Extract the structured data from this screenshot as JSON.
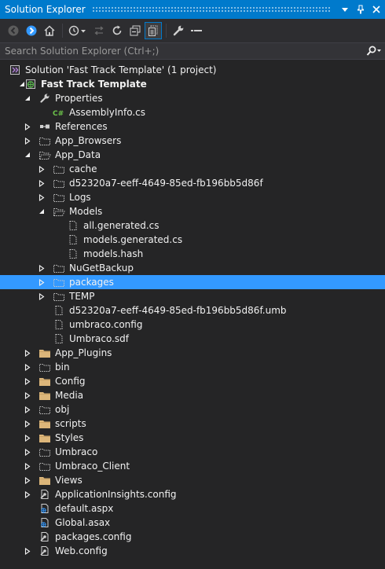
{
  "window": {
    "title": "Solution Explorer",
    "accent_color": "#007acc",
    "selection_color": "#3399ff",
    "title_icons": [
      "dropdown-arrow-icon",
      "pin-icon",
      "close-icon"
    ]
  },
  "toolbar": {
    "buttons": [
      "back-icon",
      "forward-icon",
      "home-icon",
      "history-icon",
      "sync-icon",
      "refresh-icon",
      "collapse-all-icon",
      "show-all-files-icon",
      "properties-wrench-icon",
      "preview-icon"
    ]
  },
  "search": {
    "placeholder": "Search Solution Explorer (Ctrl+;)"
  },
  "tree": {
    "items": [
      {
        "label": "Solution 'Fast Track Template' (1 project)",
        "icon": "solution",
        "depth": 0,
        "expander": "none",
        "bold": false
      },
      {
        "label": "Fast Track Template",
        "icon": "web-project",
        "depth": 1,
        "expander": "expanded",
        "bold": true
      },
      {
        "label": "Properties",
        "icon": "wrench",
        "depth": 2,
        "expander": "expanded",
        "bold": false
      },
      {
        "label": "AssemblyInfo.cs",
        "icon": "csharp",
        "depth": 3,
        "expander": "none",
        "bold": false
      },
      {
        "label": "References",
        "icon": "references",
        "depth": 2,
        "expander": "collapsed",
        "bold": false
      },
      {
        "label": "App_Browsers",
        "icon": "folder-dotted",
        "depth": 2,
        "expander": "collapsed",
        "bold": false
      },
      {
        "label": "App_Data",
        "icon": "folder-dotted-open",
        "depth": 2,
        "expander": "expanded",
        "bold": false
      },
      {
        "label": "cache",
        "icon": "folder-dotted",
        "depth": 3,
        "expander": "collapsed",
        "bold": false
      },
      {
        "label": "d52320a7-eeff-4649-85ed-fb196bb5d86f",
        "icon": "folder-dotted",
        "depth": 3,
        "expander": "collapsed",
        "bold": false
      },
      {
        "label": "Logs",
        "icon": "folder-dotted",
        "depth": 3,
        "expander": "collapsed",
        "bold": false
      },
      {
        "label": "Models",
        "icon": "folder-dotted-open",
        "depth": 3,
        "expander": "expanded",
        "bold": false
      },
      {
        "label": "all.generated.cs",
        "icon": "file-dotted",
        "depth": 4,
        "expander": "none",
        "bold": false
      },
      {
        "label": "models.generated.cs",
        "icon": "file-dotted",
        "depth": 4,
        "expander": "none",
        "bold": false
      },
      {
        "label": "models.hash",
        "icon": "file-dotted",
        "depth": 4,
        "expander": "none",
        "bold": false
      },
      {
        "label": "NuGetBackup",
        "icon": "folder-dotted",
        "depth": 3,
        "expander": "collapsed",
        "bold": false
      },
      {
        "label": "packages",
        "icon": "folder-dotted",
        "depth": 3,
        "expander": "collapsed",
        "bold": false,
        "selected": true
      },
      {
        "label": "TEMP",
        "icon": "folder-dotted",
        "depth": 3,
        "expander": "collapsed",
        "bold": false
      },
      {
        "label": "d52320a7-eeff-4649-85ed-fb196bb5d86f.umb",
        "icon": "file-dotted",
        "depth": 3,
        "expander": "none",
        "bold": false
      },
      {
        "label": "umbraco.config",
        "icon": "file-dotted",
        "depth": 3,
        "expander": "none",
        "bold": false
      },
      {
        "label": "Umbraco.sdf",
        "icon": "file-dotted",
        "depth": 3,
        "expander": "none",
        "bold": false
      },
      {
        "label": "App_Plugins",
        "icon": "folder",
        "depth": 2,
        "expander": "collapsed",
        "bold": false
      },
      {
        "label": "bin",
        "icon": "folder-dotted",
        "depth": 2,
        "expander": "collapsed",
        "bold": false
      },
      {
        "label": "Config",
        "icon": "folder",
        "depth": 2,
        "expander": "collapsed",
        "bold": false
      },
      {
        "label": "Media",
        "icon": "folder",
        "depth": 2,
        "expander": "collapsed",
        "bold": false
      },
      {
        "label": "obj",
        "icon": "folder-dotted",
        "depth": 2,
        "expander": "collapsed",
        "bold": false
      },
      {
        "label": "scripts",
        "icon": "folder",
        "depth": 2,
        "expander": "collapsed",
        "bold": false
      },
      {
        "label": "Styles",
        "icon": "folder",
        "depth": 2,
        "expander": "collapsed",
        "bold": false
      },
      {
        "label": "Umbraco",
        "icon": "folder-dotted",
        "depth": 2,
        "expander": "collapsed",
        "bold": false
      },
      {
        "label": "Umbraco_Client",
        "icon": "folder-dotted",
        "depth": 2,
        "expander": "collapsed",
        "bold": false
      },
      {
        "label": "Views",
        "icon": "folder",
        "depth": 2,
        "expander": "collapsed",
        "bold": false
      },
      {
        "label": "ApplicationInsights.config",
        "icon": "config",
        "depth": 2,
        "expander": "collapsed",
        "bold": false
      },
      {
        "label": "default.aspx",
        "icon": "web-page",
        "depth": 2,
        "expander": "none",
        "bold": false
      },
      {
        "label": "Global.asax",
        "icon": "web-page",
        "depth": 2,
        "expander": "none",
        "bold": false
      },
      {
        "label": "packages.config",
        "icon": "config",
        "depth": 2,
        "expander": "none",
        "bold": false
      },
      {
        "label": "Web.config",
        "icon": "config",
        "depth": 2,
        "expander": "collapsed",
        "bold": false
      }
    ]
  }
}
